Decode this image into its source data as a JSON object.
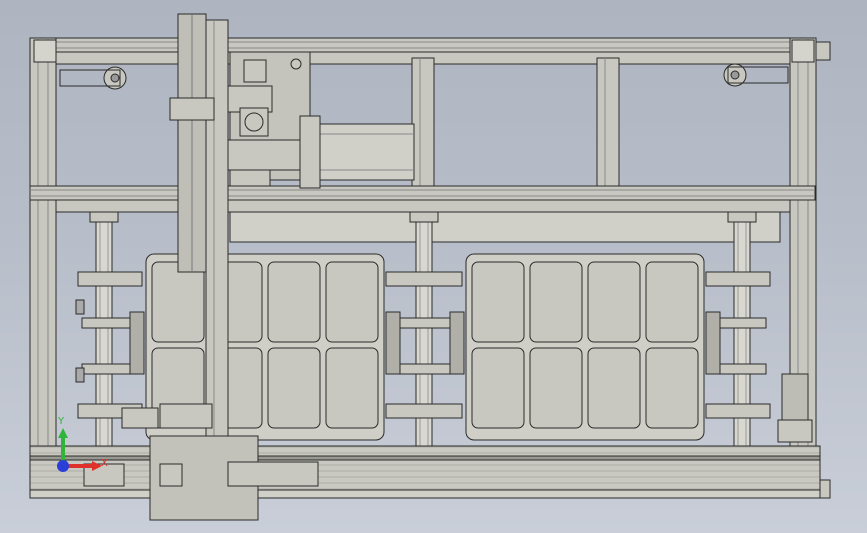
{
  "window": {
    "title": ""
  },
  "viewport": {
    "background_top": "#aeb4c0",
    "background_bottom": "#c9ced8",
    "part_fill": "#c8c8c0",
    "part_stroke": "#2a2a2a"
  },
  "triad": {
    "x_label": "X",
    "y_label": "Y",
    "x_color": "#e0302a",
    "y_color": "#2fb53a",
    "z_color": "#2a3ed8"
  },
  "model": {
    "description_icons": [
      "frame-icon",
      "gantry-icon",
      "tray-icon",
      "column-icon",
      "drag-chain-icon",
      "motor-icon"
    ]
  }
}
